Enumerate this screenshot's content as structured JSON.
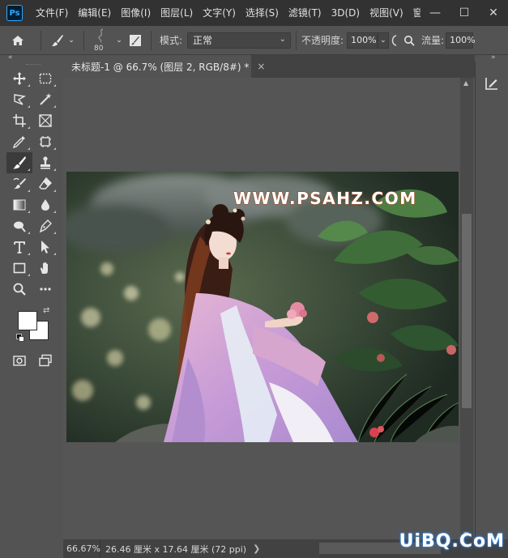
{
  "app": {
    "logo": "Ps",
    "menu": [
      "文件(F)",
      "编辑(E)",
      "图像(I)",
      "图层(L)",
      "文字(Y)",
      "选择(S)",
      "滤镜(T)",
      "3D(D)",
      "视图(V)",
      "窗口(W"
    ]
  },
  "window_controls": {
    "minimize": "—",
    "maximize": "☐",
    "close": "✕"
  },
  "options": {
    "brush_size": "80",
    "mode_label": "模式:",
    "mode_value": "正常",
    "opacity_label": "不透明度:",
    "opacity_value": "100%",
    "flow_label": "流量:",
    "flow_value": "100%"
  },
  "document": {
    "tab_title": "未标题-1 @ 66.7% (图层 2, RGB/8#) *",
    "close": "×"
  },
  "artwork": {
    "watermark": "WWW.PSAHZ.COM"
  },
  "status": {
    "zoom": "66.67%",
    "info": "26.46 厘米 x 17.64 厘米 (72 ppi)",
    "arrow": "❯"
  },
  "site_watermark": "UiBQ.CoM",
  "colors": {
    "foreground": "#ffffff",
    "background": "#ffffff"
  }
}
